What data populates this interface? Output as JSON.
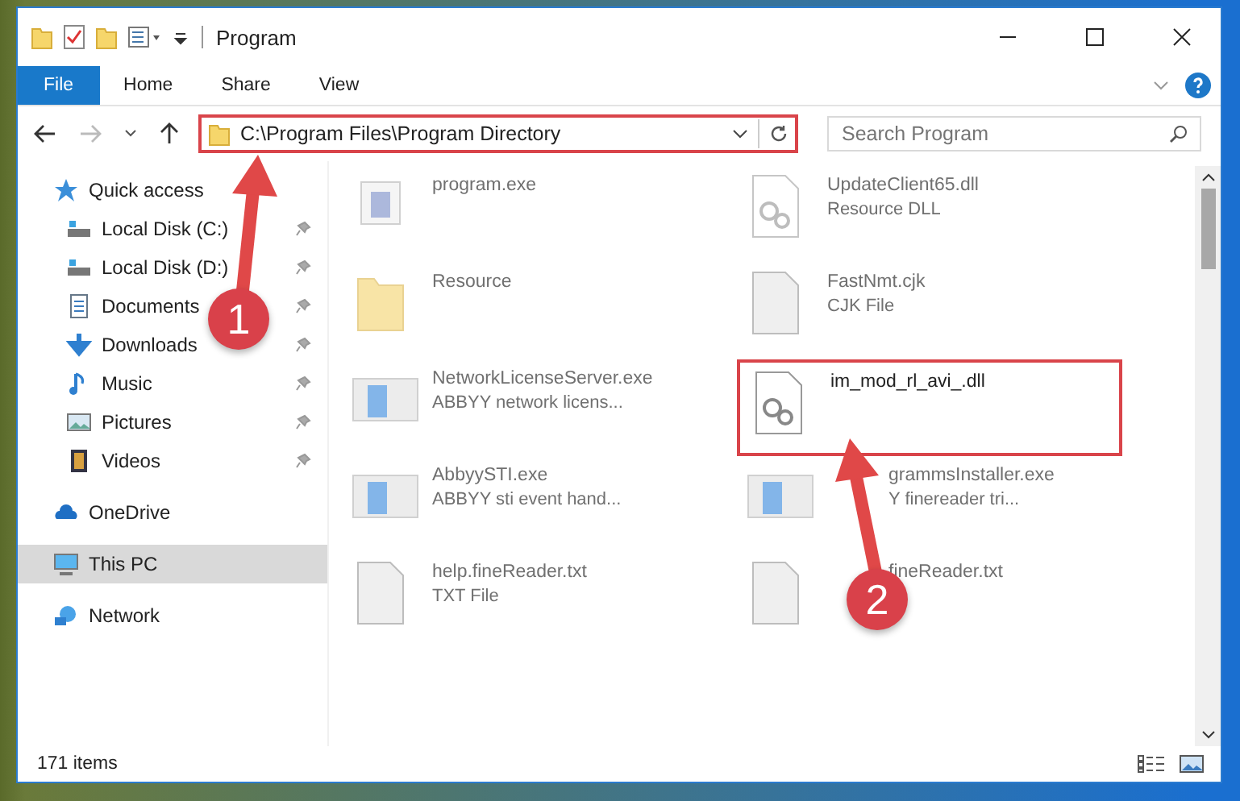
{
  "window": {
    "title": "Program"
  },
  "ribbon_tabs": [
    {
      "label": "File",
      "selected": true
    },
    {
      "label": "Home",
      "selected": false
    },
    {
      "label": "Share",
      "selected": false
    },
    {
      "label": "View",
      "selected": false
    }
  ],
  "address_bar": {
    "path": "C:\\Program Files\\Program Directory",
    "highlighted": true
  },
  "search": {
    "placeholder": "Search Program"
  },
  "sidebar": {
    "items": [
      {
        "label": "Quick access",
        "kind": "star",
        "selected": false,
        "pinned": false,
        "children": [
          {
            "label": "Local Disk (C:)",
            "kind": "disk",
            "selected": false,
            "pinned": true
          },
          {
            "label": "Local Disk (D:)",
            "kind": "disk",
            "selected": false,
            "pinned": true
          },
          {
            "label": "Documents",
            "kind": "document",
            "selected": false,
            "pinned": true
          },
          {
            "label": "Downloads",
            "kind": "download",
            "selected": false,
            "pinned": true
          },
          {
            "label": "Music",
            "kind": "music",
            "selected": false,
            "pinned": true
          },
          {
            "label": "Pictures",
            "kind": "picture",
            "selected": false,
            "pinned": true
          },
          {
            "label": "Videos",
            "kind": "video",
            "selected": false,
            "pinned": true
          }
        ]
      },
      {
        "label": "OneDrive",
        "kind": "cloud",
        "selected": false,
        "pinned": false
      },
      {
        "label": "This PC",
        "kind": "pc",
        "selected": true,
        "pinned": false
      },
      {
        "label": "Network",
        "kind": "network",
        "selected": false,
        "pinned": false
      }
    ]
  },
  "files": [
    {
      "name": "program.exe",
      "kind": "exe",
      "highlighted": false,
      "blurred": true
    },
    {
      "name": "UpdateClient65.dll",
      "type": "Resource DLL",
      "kind": "dll",
      "highlighted": false,
      "blurred": true
    },
    {
      "name": "Resource",
      "kind": "folder",
      "highlighted": false,
      "blurred": true
    },
    {
      "name": "FastNmt.cjk",
      "type": "CJK File",
      "kind": "file",
      "highlighted": false,
      "blurred": true
    },
    {
      "name": "NetworkLicenseServer.exe",
      "type": "ABBYY network licens...",
      "kind": "app",
      "highlighted": false,
      "blurred": true
    },
    {
      "name": "im_mod_rl_avi_.dll",
      "kind": "dll",
      "highlighted": true,
      "blurred": false
    },
    {
      "name": "AbbyySTI.exe",
      "type": "ABBYY sti event hand...",
      "kind": "app",
      "highlighted": false,
      "blurred": true
    },
    {
      "name": "grammsInstaller.exe",
      "type": "Y finereader tri...",
      "kind": "app",
      "highlighted": false,
      "blurred": true,
      "under_arrow": true
    },
    {
      "name": "help.fineReader.txt",
      "type": "TXT File",
      "kind": "file",
      "highlighted": false,
      "blurred": true
    },
    {
      "name": "fineReader.txt",
      "kind": "file",
      "highlighted": false,
      "blurred": true,
      "under_arrow": true
    }
  ],
  "status_bar": {
    "item_count": "171 items"
  },
  "annotations": [
    {
      "number": "1"
    },
    {
      "number": "2"
    }
  ]
}
